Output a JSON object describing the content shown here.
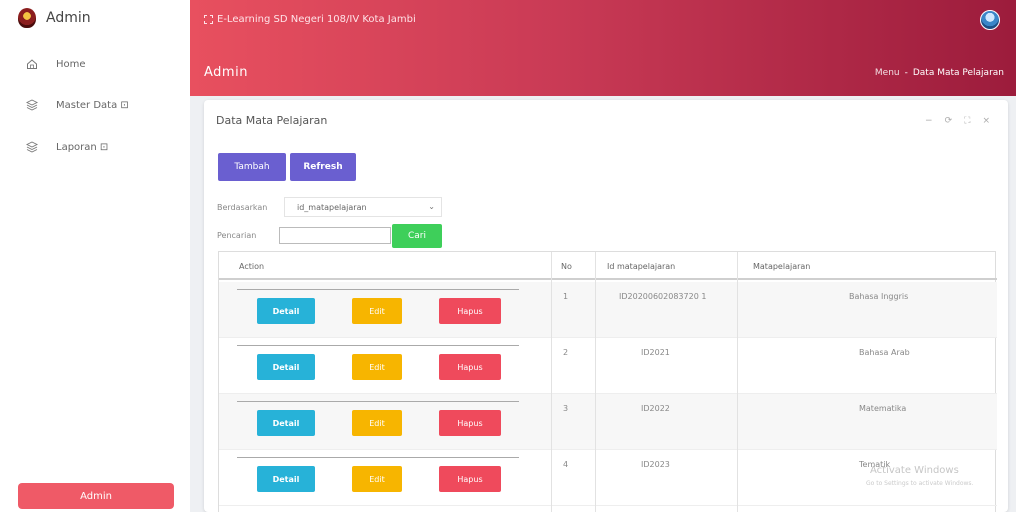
{
  "sidebar": {
    "brand": "Admin",
    "items": [
      {
        "label": "Home",
        "icon": "home-icon"
      },
      {
        "label": "Master Data ⊡",
        "icon": "layers-icon"
      },
      {
        "label": "Laporan ⊡",
        "icon": "layers-icon"
      }
    ],
    "footer_button": "Admin"
  },
  "header": {
    "site_title": "E-Learning SD Negeri 108/IV Kota Jambi",
    "page_heading": "Admin",
    "breadcrumb": [
      "Menu",
      "-",
      "Data Mata Pelajaran"
    ]
  },
  "card": {
    "title": "Data Mata Pelajaran",
    "tools": [
      "−",
      "⟳",
      "⛶",
      "×"
    ],
    "buttons": {
      "tambah": "Tambah",
      "refresh": "Refresh"
    },
    "filter": {
      "berdasarkan_label": "Berdasarkan",
      "berdasarkan_value": "id_matapelajaran",
      "pencarian_label": "Pencarian",
      "search_value": "",
      "cari_button": "Cari"
    },
    "table": {
      "headers": [
        "Action",
        "No",
        "Id matapelajaran",
        "Matapelajaran"
      ],
      "action_buttons": {
        "detail": "Detail",
        "edit": "Edit",
        "hapus": "Hapus"
      },
      "rows": [
        {
          "no": "1",
          "id": "ID20200602083720 1",
          "name": "Bahasa Inggris"
        },
        {
          "no": "2",
          "id": "ID2021",
          "name": "Bahasa Arab"
        },
        {
          "no": "3",
          "id": "ID2022",
          "name": "Matematika"
        },
        {
          "no": "4",
          "id": "ID2023",
          "name": "Tematik"
        }
      ]
    }
  },
  "watermark": {
    "title": "Activate Windows",
    "subtitle": "Go to Settings to activate Windows."
  },
  "colors": {
    "header_start": "#e8505f",
    "header_end": "#9c1c3c",
    "primary_button": "#6a5fd0",
    "search_button": "#3ecf5a",
    "detail_button": "#27b2d8",
    "edit_button": "#f7b500",
    "delete_button": "#ef4a5c"
  }
}
